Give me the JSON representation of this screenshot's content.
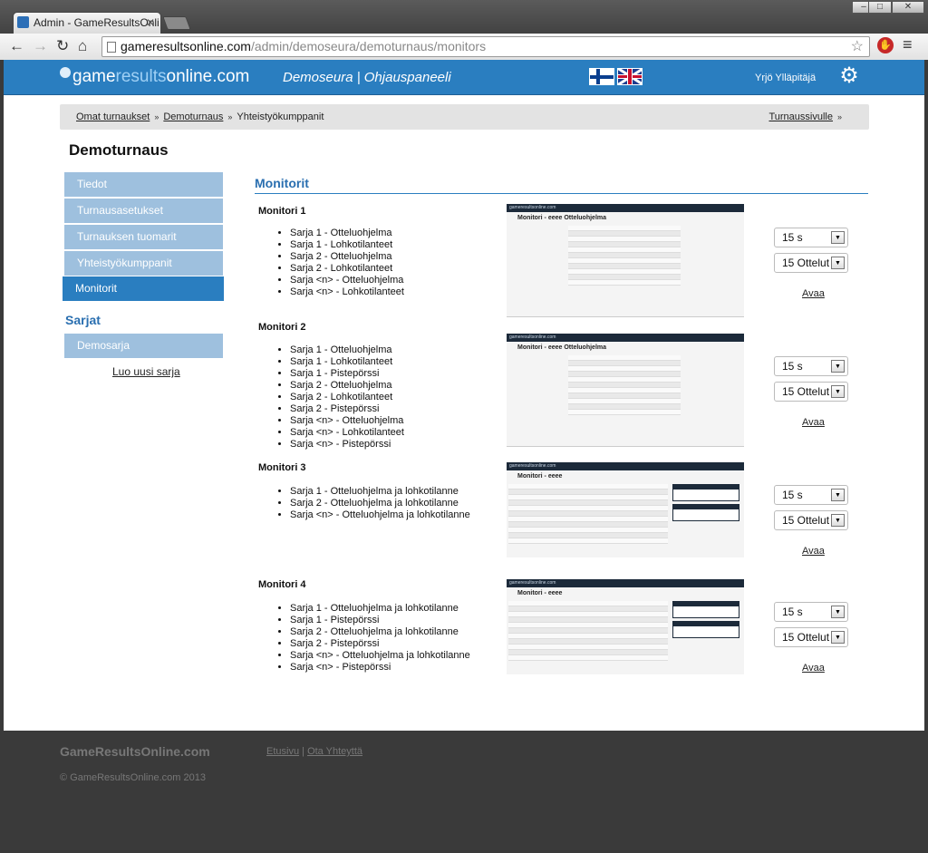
{
  "browser": {
    "tab_title": "Admin - GameResultsOnli",
    "url_domain": "gameresultsonline.com",
    "url_path": "/admin/demoseura/demoturnaus/monitors"
  },
  "header": {
    "logo_part1": "game",
    "logo_part2": "results",
    "logo_part3": "online.com",
    "org_title": "Demoseura | Ohjauspaneeli",
    "user_name": "Yrjö Ylläpitäjä"
  },
  "breadcrumb": {
    "items": [
      "Omat turnaukset",
      "Demoturnaus",
      "Yhteistyökumppanit"
    ],
    "right_link": "Turnaussivulle"
  },
  "tournament_title": "Demoturnaus",
  "sidebar": {
    "items": [
      "Tiedot",
      "Turnausasetukset",
      "Turnauksen tuomarit",
      "Yhteistyökumppanit",
      "Monitorit"
    ],
    "series_title": "Sarjat",
    "series_items": [
      "Demosarja"
    ],
    "new_series_link": "Luo uusi sarja"
  },
  "main": {
    "title": "Monitorit",
    "monitors": [
      {
        "title": "Monitori 1",
        "items": [
          "Sarja 1 - Otteluohjelma",
          "Sarja 1 - Lohkotilanteet",
          "Sarja 2 - Otteluohjelma",
          "Sarja 2 - Lohkotilanteet",
          "Sarja <n> - Otteluohjelma",
          "Sarja <n> - Lohkotilanteet"
        ],
        "preview_brand": "gameresultsonline.com",
        "preview_title": "Monitori - eeee Otteluohjelma",
        "interval": "15 s",
        "count": "15 Ottelut",
        "open_label": "Avaa"
      },
      {
        "title": "Monitori 2",
        "items": [
          "Sarja 1 - Otteluohjelma",
          "Sarja 1 - Lohkotilanteet",
          "Sarja 1 - Pistepörssi",
          "Sarja 2 - Otteluohjelma",
          "Sarja 2 - Lohkotilanteet",
          "Sarja 2 - Pistepörssi",
          "Sarja <n> - Otteluohjelma",
          "Sarja <n> - Lohkotilanteet",
          "Sarja <n> - Pistepörssi"
        ],
        "preview_brand": "gameresultsonline.com",
        "preview_title": "Monitori - eeee Otteluohjelma",
        "interval": "15 s",
        "count": "15 Ottelut",
        "open_label": "Avaa"
      },
      {
        "title": "Monitori 3",
        "items": [
          "Sarja 1 - Otteluohjelma ja lohkotilanne",
          "Sarja 2 - Otteluohjelma ja lohkotilanne",
          "Sarja <n> - Otteluohjelma ja lohkotilanne"
        ],
        "preview_brand": "gameresultsonline.com",
        "preview_title": "Monitori - eeee",
        "interval": "15 s",
        "count": "15 Ottelut",
        "open_label": "Avaa"
      },
      {
        "title": "Monitori 4",
        "items": [
          "Sarja 1 - Otteluohjelma ja lohkotilanne",
          "Sarja 1 - Pistepörssi",
          "Sarja 2 - Otteluohjelma ja lohkotilanne",
          "Sarja 2 - Pistepörssi",
          "Sarja <n> - Otteluohjelma ja lohkotilanne",
          "Sarja <n> - Pistepörssi"
        ],
        "preview_brand": "gameresultsonline.com",
        "preview_title": "Monitori - eeee",
        "interval": "15 s",
        "count": "15 Ottelut",
        "open_label": "Avaa"
      }
    ]
  },
  "footer": {
    "brand": "GameResultsOnline.com",
    "link_home": "Etusivu",
    "link_sep": "|",
    "link_contact": "Ota Yhteyttä",
    "copyright": "© GameResultsOnline.com 2013"
  },
  "colors": {
    "header_blue": "#2a7ec0",
    "sidebar_item": "#9ec0de",
    "sidebar_active": "#2a7ec0",
    "footer_bg": "#3a3a3a"
  }
}
